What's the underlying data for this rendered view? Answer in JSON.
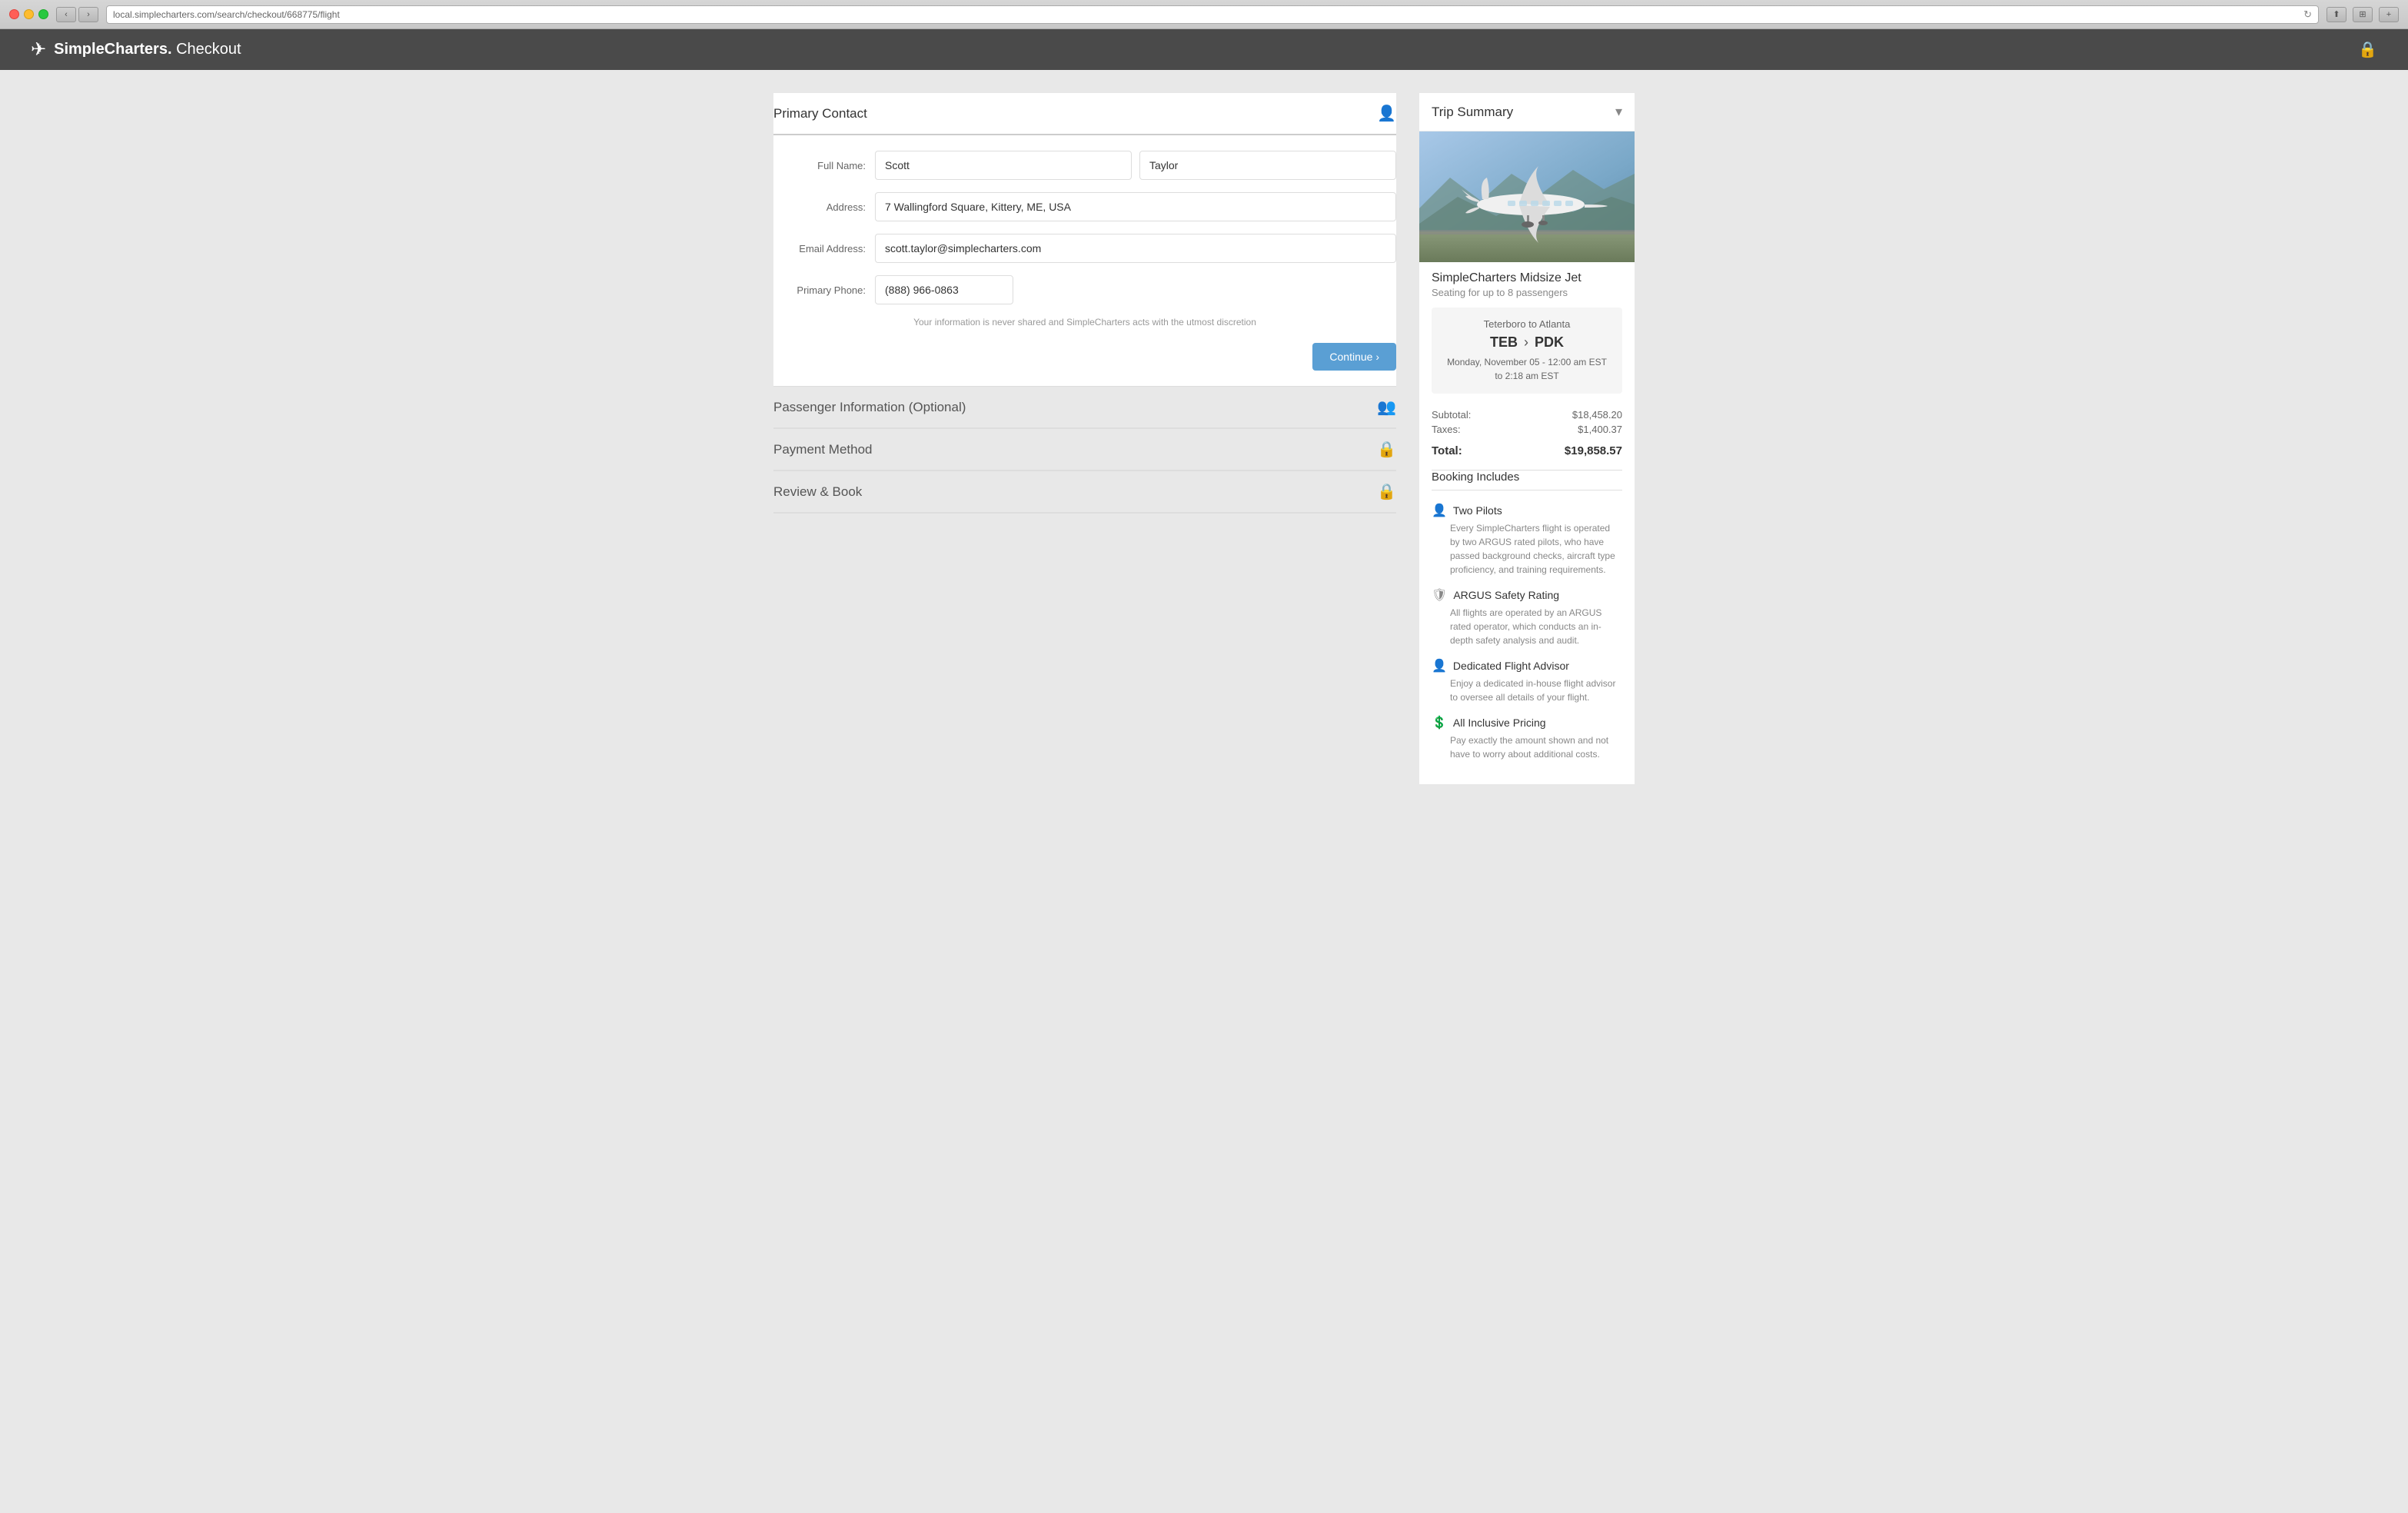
{
  "browser": {
    "url": "local.simplecharters.com/search/checkout/668775/flight",
    "back_label": "‹",
    "forward_label": "›",
    "reload_label": "↻"
  },
  "header": {
    "brand": "SimpleCharters.",
    "page_title": "Checkout",
    "lock_icon": "🔒"
  },
  "primary_contact": {
    "section_title": "Primary Contact",
    "icon": "👤",
    "fields": {
      "full_name_label": "Full Name:",
      "first_name_value": "Scott",
      "last_name_value": "Taylor",
      "address_label": "Address:",
      "address_value": "7 Wallingford Square, Kittery, ME, USA",
      "email_label": "Email Address:",
      "email_value": "scott.taylor@simplecharters.com",
      "phone_label": "Primary Phone:",
      "phone_value": "(888) 966-0863"
    },
    "privacy_note": "Your information is never shared and SimpleCharters acts with the utmost discretion",
    "continue_btn": "Continue ›"
  },
  "passenger_info": {
    "section_title": "Passenger Information (Optional)",
    "icon": "👥"
  },
  "payment_method": {
    "section_title": "Payment Method",
    "icon": "🔒"
  },
  "review_book": {
    "section_title": "Review & Book",
    "icon": "🔒"
  },
  "trip_summary": {
    "title": "Trip Summary",
    "toggle_icon": "▾",
    "jet_name": "SimpleCharters Midsize Jet",
    "jet_capacity": "Seating for up to 8 passengers",
    "flight": {
      "route_text": "Teterboro to Atlanta",
      "origin_code": "TEB",
      "dest_code": "PDK",
      "arrow": "›",
      "date_time": "Monday, November 05 - 12:00 am EST to 2:18 am EST"
    },
    "pricing": {
      "subtotal_label": "Subtotal:",
      "subtotal_value": "$18,458.20",
      "taxes_label": "Taxes:",
      "taxes_value": "$1,400.37",
      "total_label": "Total:",
      "total_value": "$19,858.57"
    },
    "booking_includes": {
      "title": "Booking Includes",
      "items": [
        {
          "icon": "👤",
          "title": "Two Pilots",
          "description": "Every SimpleCharters flight is operated by two ARGUS rated pilots, who have passed background checks, aircraft type proficiency, and training requirements."
        },
        {
          "icon": "🛡",
          "title": "ARGUS Safety Rating",
          "description": "All flights are operated by an ARGUS rated operator, which conducts an in-depth safety analysis and audit."
        },
        {
          "icon": "👤",
          "title": "Dedicated Flight Advisor",
          "description": "Enjoy a dedicated in-house flight advisor to oversee all details of your flight."
        },
        {
          "icon": "💲",
          "title": "All Inclusive Pricing",
          "description": "Pay exactly the amount shown and not have to worry about additional costs."
        }
      ]
    }
  }
}
